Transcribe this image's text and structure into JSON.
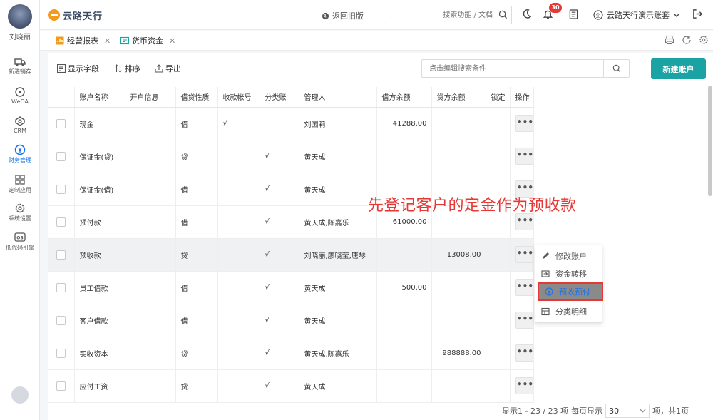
{
  "user": {
    "name": "刘晓丽"
  },
  "sidebar": {
    "items": [
      {
        "label": "新进销存",
        "icon": "truck-icon"
      },
      {
        "label": "WeOA",
        "icon": "target-icon"
      },
      {
        "label": "CRM",
        "icon": "crm-icon"
      },
      {
        "label": "财务管理",
        "icon": "finance-icon",
        "active": true
      },
      {
        "label": "定制应用",
        "icon": "grid-icon"
      },
      {
        "label": "系统设置",
        "icon": "gear-icon"
      },
      {
        "label": "低代码引擎",
        "icon": "code-icon"
      }
    ]
  },
  "header": {
    "logo_text": "云路天行",
    "old_version": "返回旧版",
    "search_placeholder": "搜索功能 / 文档",
    "notification_count": "30",
    "company": "云路天行演示账套"
  },
  "tabs": [
    {
      "label": "经营报表"
    },
    {
      "label": "货币资金"
    }
  ],
  "toolbar": {
    "show_fields": "显示字段",
    "sort": "排序",
    "export": "导出",
    "filter_placeholder": "点击编辑搜索条件",
    "new_account": "新建账户"
  },
  "table": {
    "columns": [
      "账户名称",
      "开户信息",
      "借贷性质",
      "收款帐号",
      "分类账",
      "管理人",
      "借方余额",
      "贷方余额",
      "锁定",
      "操作"
    ],
    "rows": [
      {
        "name": "现金",
        "info": "",
        "nature": "借",
        "receipt": "√",
        "ledger": "",
        "manager": "刘国莉",
        "debit": "41288.00",
        "credit": "",
        "lock": ""
      },
      {
        "name": "保证金(贷)",
        "info": "",
        "nature": "贷",
        "receipt": "",
        "ledger": "√",
        "manager": "黄天成",
        "debit": "",
        "credit": "",
        "lock": ""
      },
      {
        "name": "保证金(借)",
        "info": "",
        "nature": "借",
        "receipt": "",
        "ledger": "√",
        "manager": "黄天成",
        "debit": "",
        "credit": "",
        "lock": ""
      },
      {
        "name": "预付款",
        "info": "",
        "nature": "借",
        "receipt": "",
        "ledger": "√",
        "manager": "黄天成,陈嘉乐",
        "debit": "61000.00",
        "credit": "",
        "lock": ""
      },
      {
        "name": "预收款",
        "info": "",
        "nature": "贷",
        "receipt": "",
        "ledger": "√",
        "manager": "刘晓丽,廖晓莹,唐琴",
        "debit": "",
        "credit": "13008.00",
        "lock": ""
      },
      {
        "name": "员工借款",
        "info": "",
        "nature": "借",
        "receipt": "",
        "ledger": "√",
        "manager": "黄天成",
        "debit": "500.00",
        "credit": "",
        "lock": ""
      },
      {
        "name": "客户借款",
        "info": "",
        "nature": "借",
        "receipt": "",
        "ledger": "√",
        "manager": "黄天成",
        "debit": "",
        "credit": "",
        "lock": ""
      },
      {
        "name": "实收资本",
        "info": "",
        "nature": "贷",
        "receipt": "",
        "ledger": "√",
        "manager": "黄天成,陈嘉乐",
        "debit": "",
        "credit": "988888.00",
        "lock": ""
      },
      {
        "name": "应付工资",
        "info": "",
        "nature": "贷",
        "receipt": "",
        "ledger": "√",
        "manager": "黄天成",
        "debit": "",
        "credit": "",
        "lock": ""
      }
    ],
    "more_label": "•••"
  },
  "context_menu": {
    "items": [
      {
        "label": "修改账户",
        "icon": "edit-icon"
      },
      {
        "label": "资金转移",
        "icon": "transfer-icon"
      },
      {
        "label": "预收预付",
        "icon": "prepay-icon",
        "selected": true
      },
      {
        "label": "分类明细",
        "icon": "detail-icon"
      }
    ]
  },
  "annotation": "先登记客户的定金作为预收款",
  "pagination": {
    "summary": "显示1 - 23 / 23 项",
    "per_page_label": "每页显示",
    "page_size": "30",
    "suffix": "项，共1页"
  },
  "colors": {
    "accent": "#1ba3a3",
    "active_nav": "#1a73e8",
    "annotation": "#e53935",
    "badge": "#e53935"
  }
}
